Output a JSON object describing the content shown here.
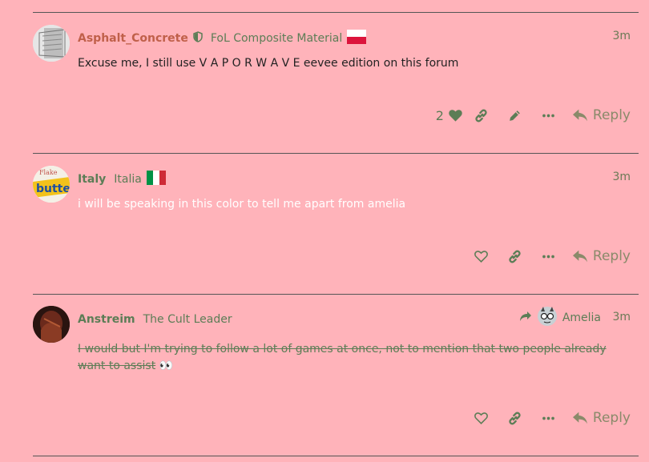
{
  "posts": [
    {
      "username": "Asphalt_Concrete",
      "username_color": "#c0604a",
      "user_title": "FoL Composite Material",
      "flag": "poland",
      "time": "3m",
      "text": "Excuse me, I still use V A P O R W A V E eevee edition on this forum",
      "text_color": "#222222",
      "like_count": "2",
      "liked": true,
      "reply_label": "Reply"
    },
    {
      "username": "Italy",
      "username_color": "#5c7d56",
      "user_title": "Italia",
      "flag": "italy",
      "time": "3m",
      "text": "i will be speaking in this color to tell me apart from amelia",
      "text_color": "#ffffff",
      "reply_label": "Reply"
    },
    {
      "username": "Anstreim",
      "username_color": "#5c7d56",
      "user_title": "The Cult Leader",
      "reply_to": "Amelia",
      "time": "3m",
      "text_line1": "I would but I'm trying to follow a lot of games at once, not to mention that two people already",
      "text_line2": "want to assist",
      "text_emoji": "👀",
      "text_color": "#5c7d56",
      "reply_label": "Reply"
    }
  ],
  "colors": {
    "background": "#ffb3ba",
    "accent": "#5c7d56",
    "divider": "#555555"
  }
}
